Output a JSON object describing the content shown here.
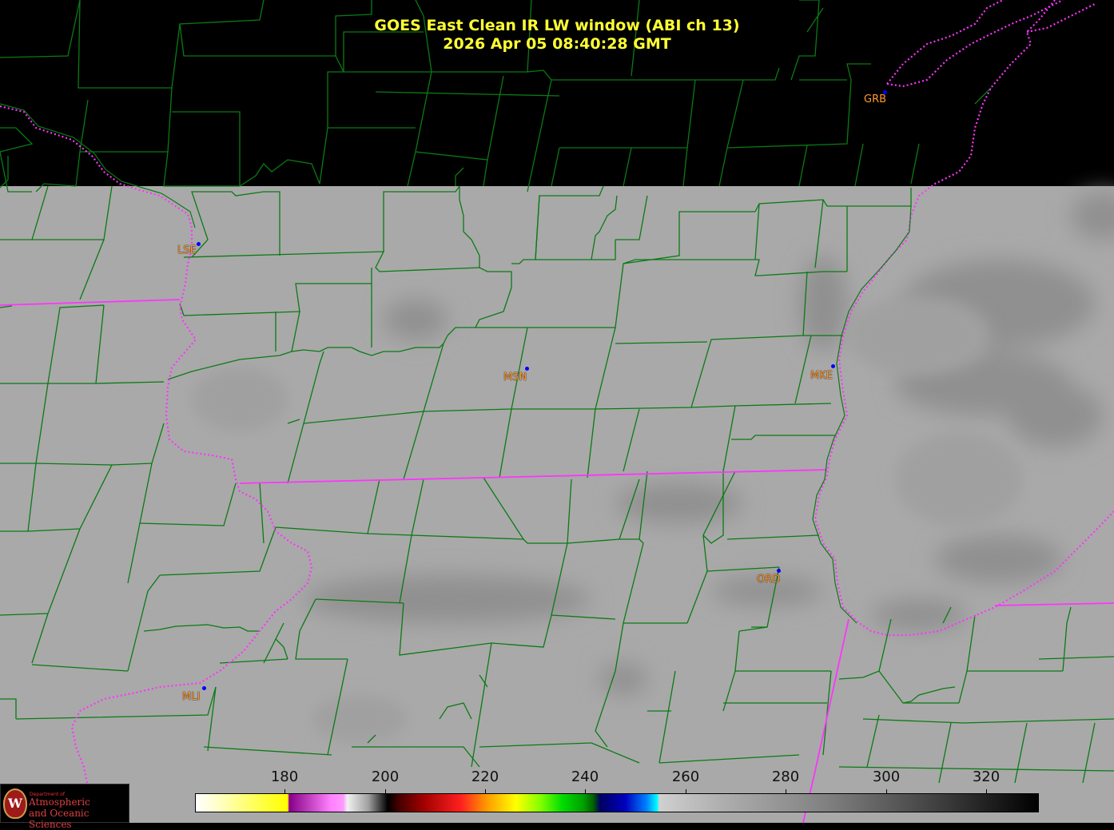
{
  "title": {
    "line1": "GOES East Clean IR LW window (ABI ch 13)",
    "line2": "2026 Apr 05  08:40:28 GMT"
  },
  "colors": {
    "background": "#000000",
    "county_lines": "#0b7a14",
    "state_lines": "#ff33ff",
    "title_text": "#ffff33",
    "city_label": "#ff9a2e",
    "city_marker": "#0000ff",
    "ir_surface": "#a9a9a9",
    "ir_cloud": "#8e8e8e"
  },
  "cities": [
    {
      "code": "GRB"
    },
    {
      "code": "LSE"
    },
    {
      "code": "MSN"
    },
    {
      "code": "MKE"
    },
    {
      "code": "ORD"
    },
    {
      "code": "MLI"
    }
  ],
  "colorbar": {
    "ticks": [
      "180",
      "200",
      "220",
      "240",
      "260",
      "280",
      "300",
      "320"
    ]
  },
  "logo": {
    "seal_letter": "W",
    "department": "Department of",
    "name_line1": "Atmospheric",
    "name_line2": "and Oceanic Sciences"
  }
}
